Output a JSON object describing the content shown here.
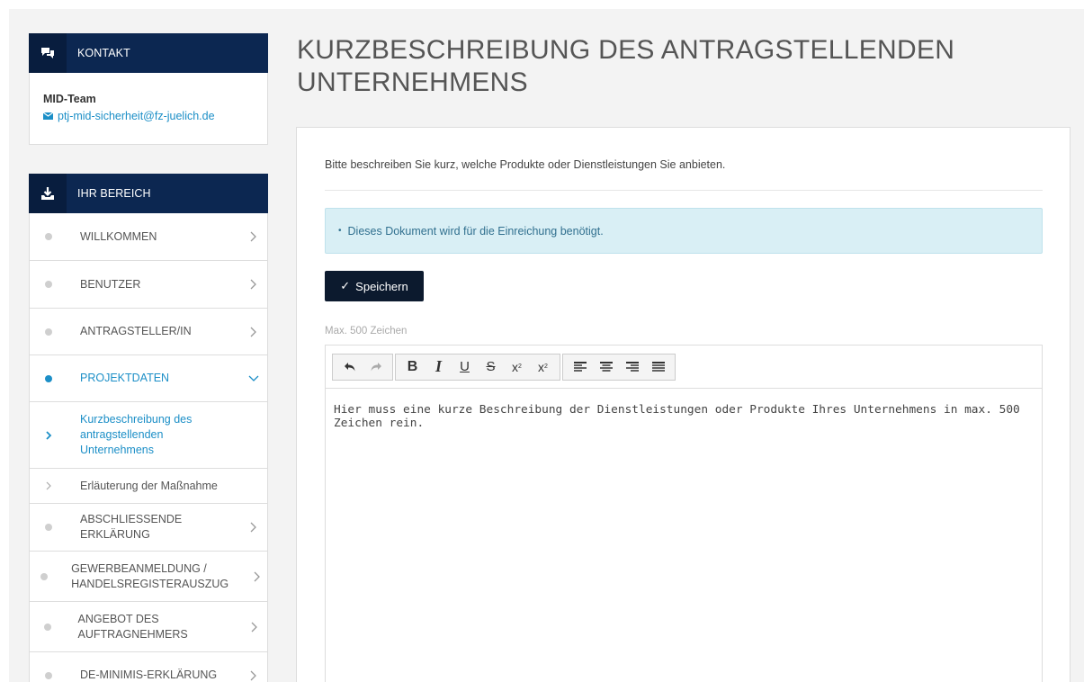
{
  "contact": {
    "heading": "KONTAKT",
    "team": "MID-Team",
    "email": "ptj-mid-sicherheit@fz-juelich.de"
  },
  "area": {
    "heading": "IHR BEREICH",
    "items": [
      {
        "label": "WILLKOMMEN",
        "state": "collapsed"
      },
      {
        "label": "BENUTZER",
        "state": "collapsed"
      },
      {
        "label": "ANTRAGSTELLER/IN",
        "state": "collapsed"
      },
      {
        "label": "PROJEKTDATEN",
        "state": "expanded"
      },
      {
        "label": "ABSCHLIESSENDE ERKLÄRUNG",
        "state": "collapsed"
      },
      {
        "label": "GEWERBEANMELDUNG / HANDELSREGISTERAUSZUG",
        "state": "collapsed"
      },
      {
        "label": "ANGEBOT DES AUFTRAGNEHMERS",
        "state": "collapsed"
      },
      {
        "label": "DE-MINIMIS-ERKLÄRUNG",
        "state": "collapsed"
      }
    ],
    "subitems": [
      {
        "label": "Kurzbeschreibung des antragstellenden Unternehmens",
        "current": true
      },
      {
        "label": "Erläuterung der Maßnahme",
        "current": false
      }
    ]
  },
  "main": {
    "title": "KURZBESCHREIBUNG DES ANTRAGSTELLENDEN UNTERNEHMENS",
    "intro": "Bitte beschreiben Sie kurz, welche Produkte oder Dienstleistungen Sie anbieten.",
    "alert": "Dieses Dokument wird für die Einreichung benötigt.",
    "save_label": "Speichern",
    "max_chars": "Max. 500 Zeichen",
    "editor_text": "Hier muss eine kurze Beschreibung der Dienstleistungen oder Produkte Ihres Unternehmens in max. 500 Zeichen rein."
  },
  "colors": {
    "navy": "#0c2751",
    "accent": "#1c8fc7",
    "alert_bg": "#d9eff5",
    "button": "#0c1a2e"
  },
  "icons": {
    "contact": "chat-bubbles-icon",
    "area": "download-tray-icon",
    "email": "envelope-icon"
  }
}
